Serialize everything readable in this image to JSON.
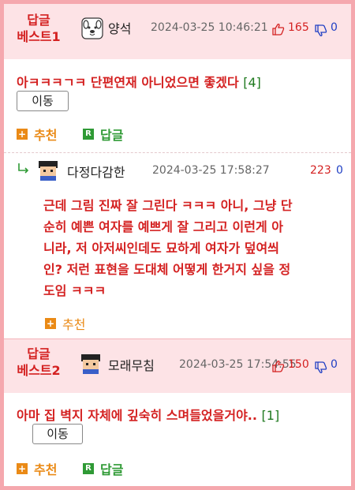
{
  "comment1": {
    "best_label_line1": "답글",
    "best_label_line2": "베스트1",
    "nickname": "양석",
    "date": "2024-03-25 10:46:21",
    "up_count": "165",
    "down_count": "0",
    "title": "아ㅋㅋㅋㄱㅋ 단편연재 아니었으면 좋겠다",
    "comment_count": "[4]",
    "move_label": "이동",
    "recommend_label": "추천",
    "reply_label": "답글"
  },
  "reply": {
    "nickname": "다정다감한",
    "date": "2024-03-25 17:58:27",
    "up_count": "223",
    "down_count": "0",
    "body_lines": [
      "근데 그림 진짜 잘 그린다 ㅋㅋㅋ 아니, 그냥 단",
      "순히 예쁜 여자를 예쁘게 잘 그리고 이런게 아",
      "니라, 저 아저씨인데도 묘하게 여자가 덮여씌",
      "인? 저런 표현을 도대체 어떻게 한거지 싶을 정",
      "도임 ㅋㅋㅋ"
    ],
    "recommend_label": "추천"
  },
  "comment2": {
    "best_label_line1": "답글",
    "best_label_line2": "베스트2",
    "nickname": "모래무침",
    "date": "2024-03-25 17:54:55",
    "up_count": "150",
    "down_count": "0",
    "title": "아마 집 벽지 자체에 깊숙히 스며들었을거야..",
    "comment_count": "[1]",
    "move_label": "이동",
    "recommend_label": "추천",
    "reply_label": "답글"
  },
  "colors": {
    "accent_red": "#d42121",
    "down_blue": "#1f3fc4",
    "header_pink": "#fde3e6",
    "border_pink": "#f5a8ae",
    "recommend_orange": "#ea8a16",
    "reply_green": "#2f9a35"
  },
  "icons": [
    "dog-avatar-icon",
    "pixel-avatar-icon",
    "thumbs-up-icon",
    "thumbs-down-icon",
    "reply-arrow-icon",
    "plus-icon",
    "reply-r-icon"
  ]
}
